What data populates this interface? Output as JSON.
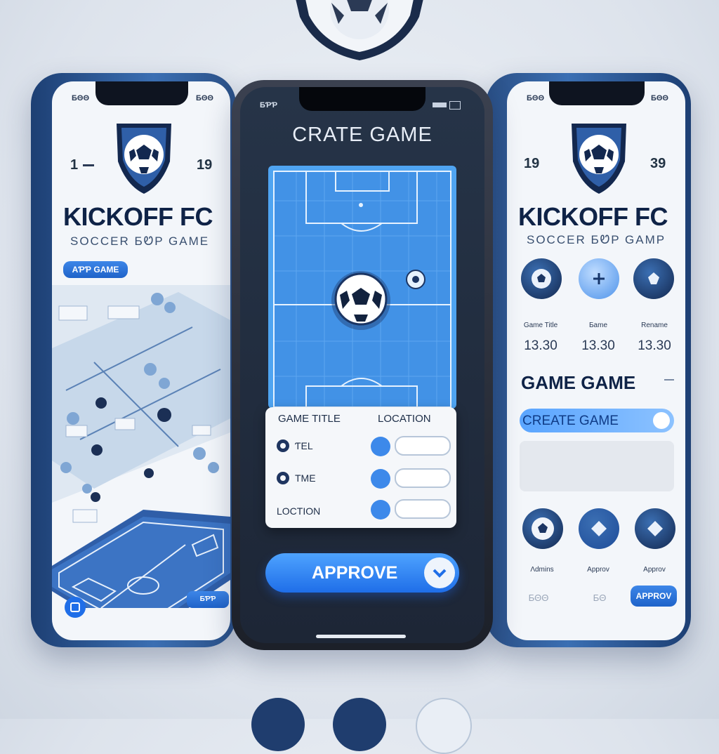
{
  "left_screen": {
    "status_left": "ƂΘΘ",
    "status_right": "ƂΘΘ",
    "score_left": "1",
    "score_right": "19",
    "title": "KICKOFF FC",
    "subtitle": "SOCCER ƂᏬP GAME",
    "add_game_chip": "AƤƤ GAME",
    "bottom_chip": "ƂƤƤ"
  },
  "middle_screen": {
    "status_left": "ƂƤƤ",
    "title": "CRATE GAME",
    "form": {
      "header_left": "GAME TITLE",
      "header_right": "LOCATION",
      "row1_label": "ƬEL",
      "row2_label": "TME",
      "row3_label": "LOCTION"
    },
    "approve_label": "APPROVE"
  },
  "right_screen": {
    "status_left": "ƂΘΘ",
    "status_right": "ƂΘΘ",
    "score_left": "19",
    "score_right": "39",
    "title": "KICKOFF FC",
    "subtitle": "SOCCER ƂᏬP GAMP",
    "stat_labels": [
      "Game Title",
      "Ƃame",
      "Rename"
    ],
    "stat_values": [
      "13.30",
      "13.30",
      "13.30"
    ],
    "section_title": "GAME GAME",
    "create_game_field": "CREATE GAME",
    "action_labels": [
      "Ʌdmins",
      "Approv",
      "Approv"
    ],
    "bottom_left": "ƂΘΘ",
    "bottom_mid": "ƂΘ",
    "approve_chip": "APPROV"
  },
  "colors": {
    "accent_blue": "#1f6ee8",
    "navy": "#0f2347",
    "pitch_blue": "#3f8fe0",
    "background": "#dde3ec"
  },
  "icons": [
    "shield-soccer-icon",
    "soccer-ball-icon",
    "plus-icon",
    "chevron-down-icon",
    "calendar-icon",
    "location-pin-icon"
  ]
}
